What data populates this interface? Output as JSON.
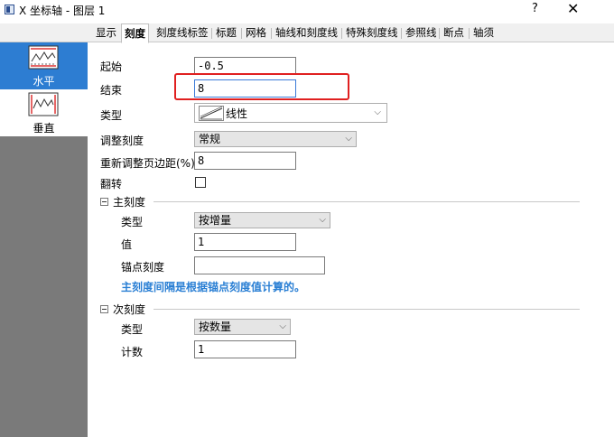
{
  "window": {
    "title": "X 坐标轴 - 图层 1",
    "help": "?",
    "close": "✕"
  },
  "tabs": [
    "显示",
    "刻度",
    "刻度线标签",
    "标题",
    "网格",
    "轴线和刻度线",
    "特殊刻度线",
    "参照线",
    "断点",
    "轴须"
  ],
  "active_tab": "刻度",
  "sidebar": {
    "items": [
      {
        "label": "水平",
        "selected": true,
        "icon": "horizontal-axis-icon"
      },
      {
        "label": "垂直",
        "selected": false,
        "icon": "vertical-axis-icon"
      }
    ]
  },
  "form": {
    "start_label": "起始",
    "start_value": "-0.5",
    "end_label": "结束",
    "end_value": "8",
    "type_label": "类型",
    "type_value": "线性",
    "rescale_label": "调整刻度",
    "rescale_value": "常规",
    "margin_label": "重新调整页边距(%)",
    "margin_value": "8",
    "flip_label": "翻转",
    "flip_checked": false
  },
  "major": {
    "group_label": "主刻度",
    "type_label": "类型",
    "type_value": "按增量",
    "value_label": "值",
    "value_value": "1",
    "anchor_label": "锚点刻度",
    "anchor_value": "",
    "note": "主刻度间隔是根据锚点刻度值计算的。"
  },
  "minor": {
    "group_label": "次刻度",
    "type_label": "类型",
    "type_value": "按数量",
    "count_label": "计数",
    "count_value": "1"
  },
  "colors": {
    "selection": "#2d7dd2",
    "highlight": "#e02020",
    "note": "#2a7fd4"
  }
}
